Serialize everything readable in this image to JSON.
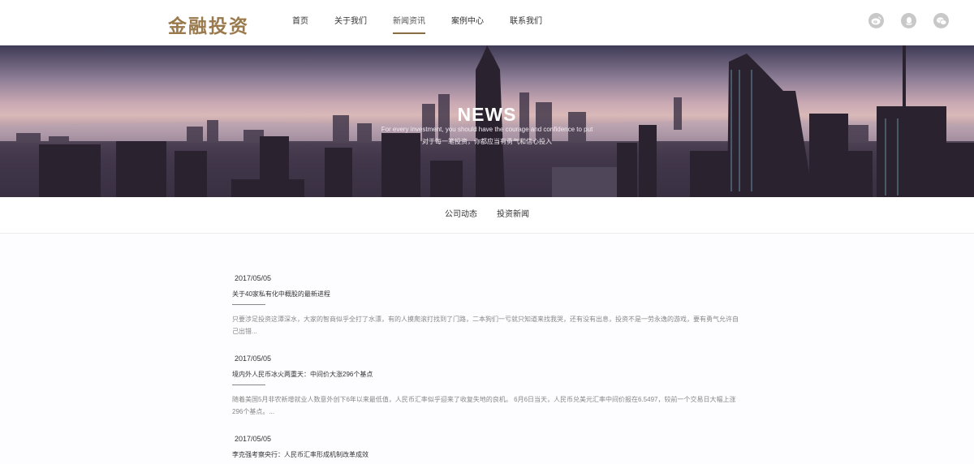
{
  "header": {
    "logo": "金融投资",
    "nav": [
      "首页",
      "关于我们",
      "新闻资讯",
      "案例中心",
      "联系我们"
    ],
    "active_nav": "新闻资讯",
    "social_icons": [
      "weibo-icon",
      "qq-icon",
      "wechat-icon"
    ]
  },
  "banner": {
    "title": "NEWS",
    "subtitle_en": "For every investment, you should have the courage and confidence to put",
    "subtitle_cn": "对于每一笔投资，你都应当有勇气和信心投入"
  },
  "subnav": [
    "公司动态",
    "投资新闻"
  ],
  "news": [
    {
      "date": "2017/05/05",
      "title": "关于40家私有化中概股的最新进程",
      "summary": "只要涉足投资这潭深水，大家的智商似乎全打了水漂，有的人摸爬滚打找到了门路，二本狗们一亏就只知道来找我哭，还有没有出息，投资不是一劳永逸的游戏，要有勇气允许自己出错..."
    },
    {
      "date": "2017/05/05",
      "title": "境内外人民币冰火两重天：中间价大涨296个基点",
      "summary": "随着美国5月非农新增就业人数意外创下6年以来最低值，人民币汇率似乎迎来了收复失地的良机。 6月6日当天，人民币兑美元汇率中间价报在6.5497，较前一个交易日大幅上涨296个基点。..."
    },
    {
      "date": "2017/05/05",
      "title": "李克强考察央行：人民币汇率形成机制改革成效"
    }
  ]
}
